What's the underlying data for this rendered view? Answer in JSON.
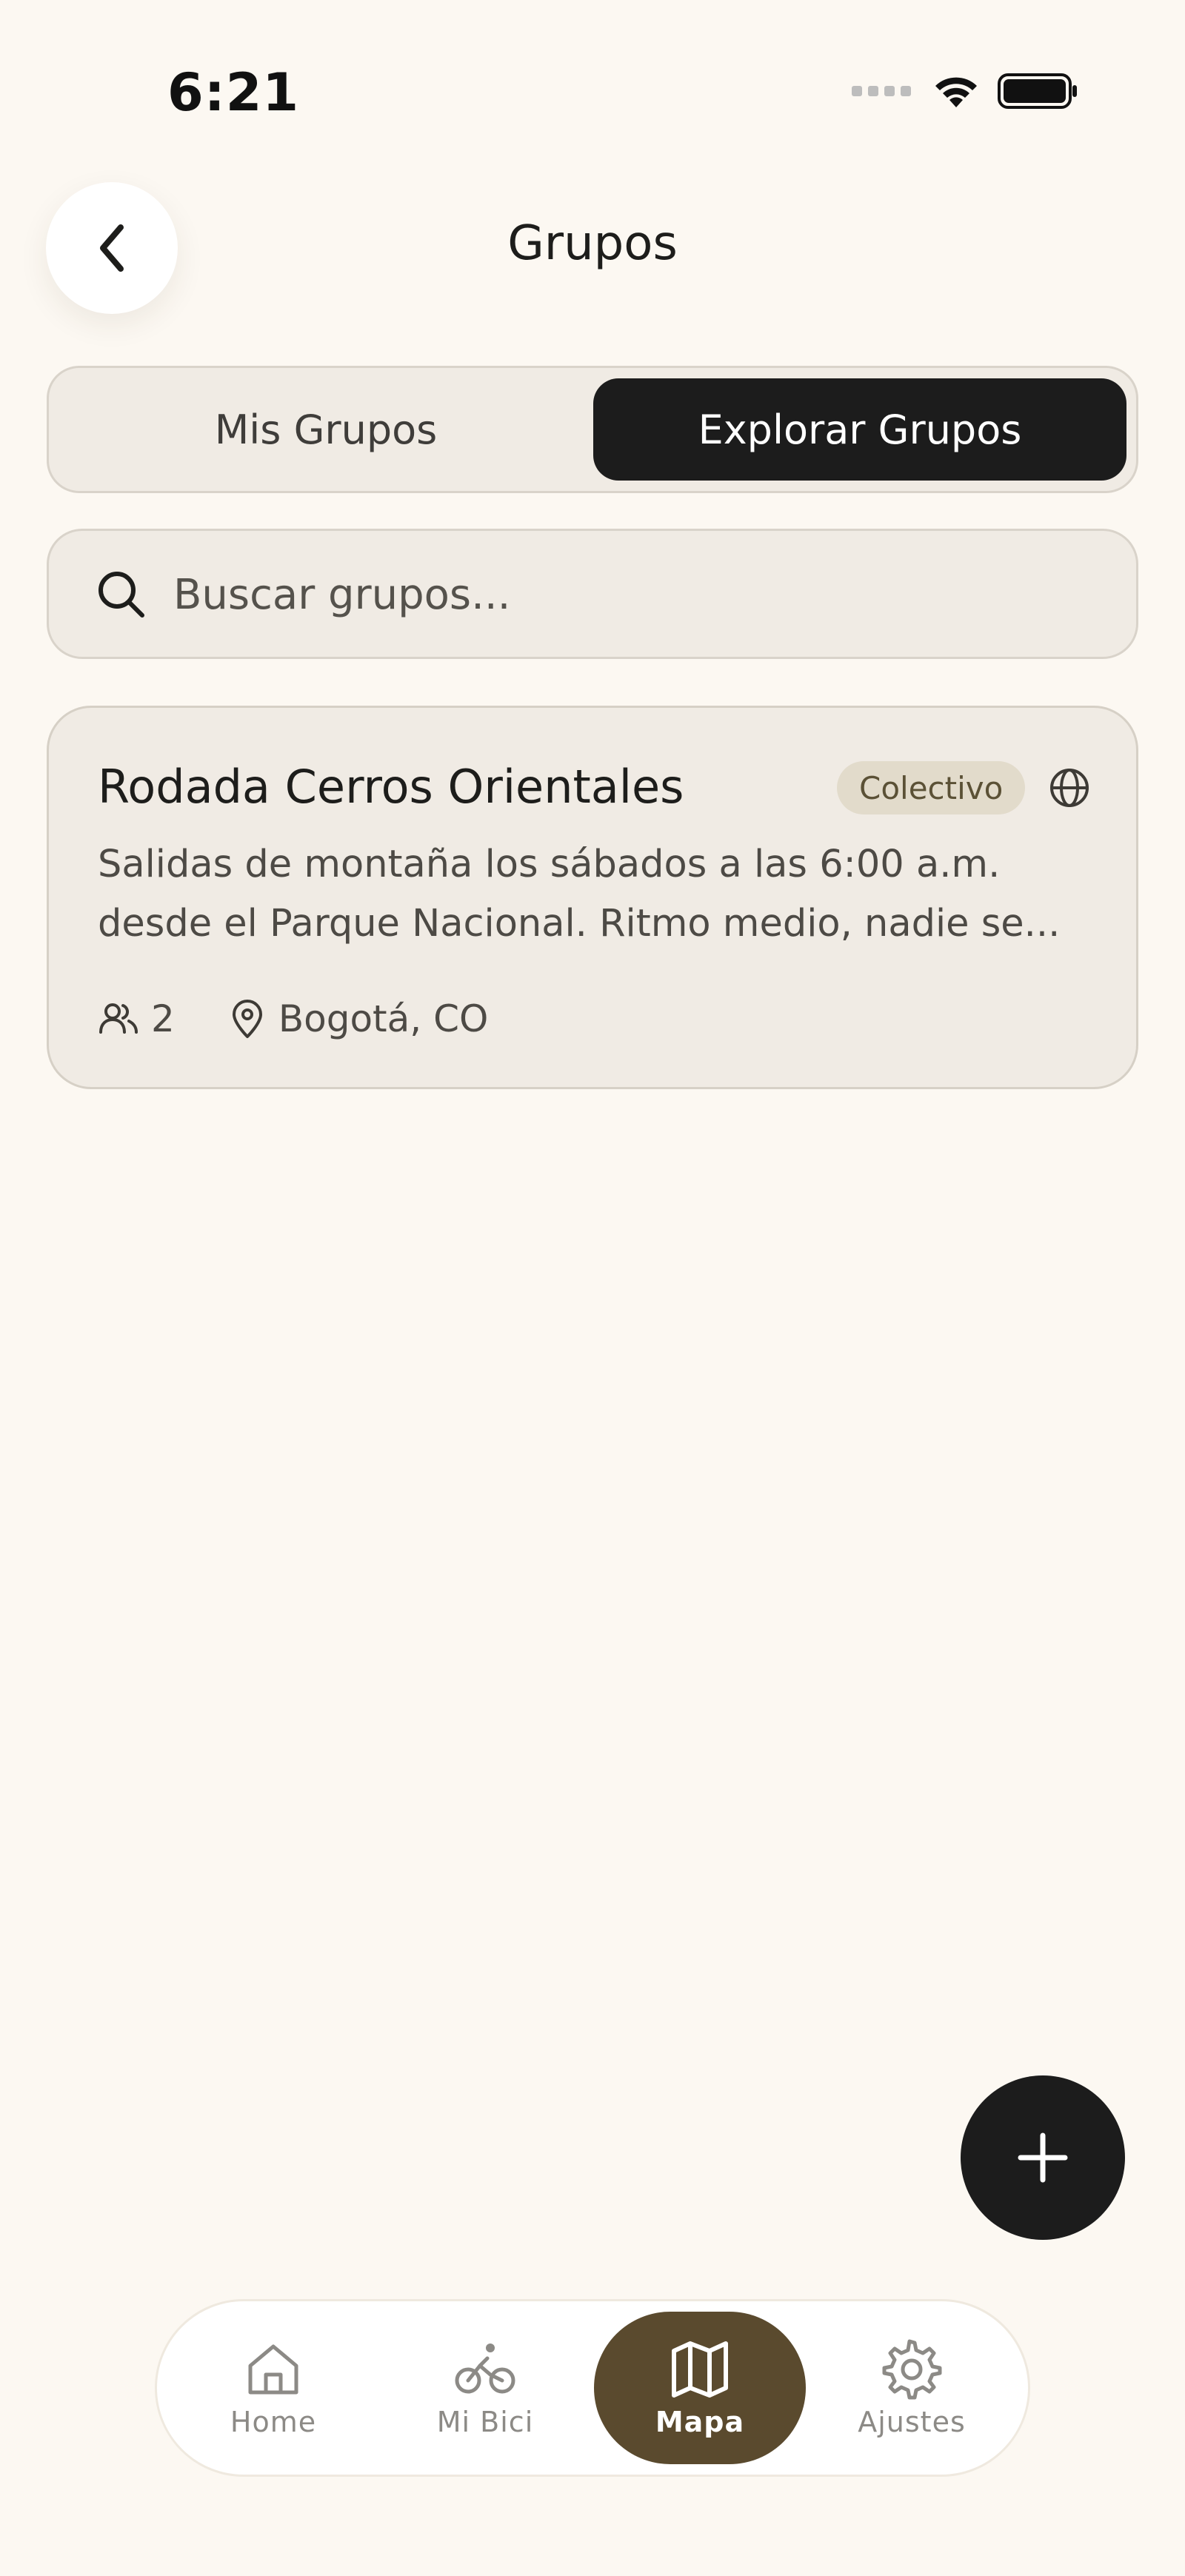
{
  "status_bar": {
    "time": "6:21"
  },
  "header": {
    "title": "Grupos"
  },
  "tabs": [
    {
      "label": "Mis Grupos",
      "active": false
    },
    {
      "label": "Explorar Grupos",
      "active": true
    }
  ],
  "search": {
    "placeholder": "Buscar grupos..."
  },
  "groups": [
    {
      "name": "Rodada Cerros Orientales",
      "badge": "Colectivo",
      "description": "Salidas de montaña los sábados a las 6:00 a.m. desde el Parque Nacional. Ritmo medio, nadie se...",
      "members": "2",
      "location": "Bogotá, CO",
      "visibility_icon": "globe-icon"
    }
  ],
  "bottom_nav": [
    {
      "label": "Home",
      "icon": "home-icon",
      "active": false
    },
    {
      "label": "Mi Bici",
      "icon": "bicycle-icon",
      "active": false
    },
    {
      "label": "Mapa",
      "icon": "map-icon",
      "active": true
    },
    {
      "label": "Ajustes",
      "icon": "gear-icon",
      "active": false
    }
  ],
  "colors": {
    "background": "#FCF8F2",
    "active_dark": "#1C1C1C",
    "nav_active": "#5A4A2E",
    "badge_bg": "#E2DBCB"
  }
}
